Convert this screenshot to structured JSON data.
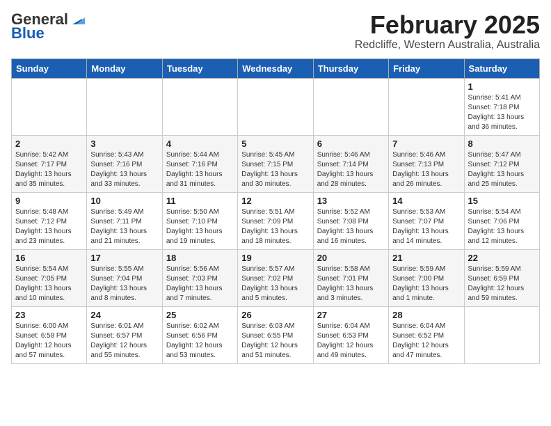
{
  "header": {
    "logo_general": "General",
    "logo_blue": "Blue",
    "title": "February 2025",
    "subtitle": "Redcliffe, Western Australia, Australia"
  },
  "weekdays": [
    "Sunday",
    "Monday",
    "Tuesday",
    "Wednesday",
    "Thursday",
    "Friday",
    "Saturday"
  ],
  "weeks": [
    [
      {
        "day": "",
        "info": ""
      },
      {
        "day": "",
        "info": ""
      },
      {
        "day": "",
        "info": ""
      },
      {
        "day": "",
        "info": ""
      },
      {
        "day": "",
        "info": ""
      },
      {
        "day": "",
        "info": ""
      },
      {
        "day": "1",
        "info": "Sunrise: 5:41 AM\nSunset: 7:18 PM\nDaylight: 13 hours\nand 36 minutes."
      }
    ],
    [
      {
        "day": "2",
        "info": "Sunrise: 5:42 AM\nSunset: 7:17 PM\nDaylight: 13 hours\nand 35 minutes."
      },
      {
        "day": "3",
        "info": "Sunrise: 5:43 AM\nSunset: 7:16 PM\nDaylight: 13 hours\nand 33 minutes."
      },
      {
        "day": "4",
        "info": "Sunrise: 5:44 AM\nSunset: 7:16 PM\nDaylight: 13 hours\nand 31 minutes."
      },
      {
        "day": "5",
        "info": "Sunrise: 5:45 AM\nSunset: 7:15 PM\nDaylight: 13 hours\nand 30 minutes."
      },
      {
        "day": "6",
        "info": "Sunrise: 5:46 AM\nSunset: 7:14 PM\nDaylight: 13 hours\nand 28 minutes."
      },
      {
        "day": "7",
        "info": "Sunrise: 5:46 AM\nSunset: 7:13 PM\nDaylight: 13 hours\nand 26 minutes."
      },
      {
        "day": "8",
        "info": "Sunrise: 5:47 AM\nSunset: 7:12 PM\nDaylight: 13 hours\nand 25 minutes."
      }
    ],
    [
      {
        "day": "9",
        "info": "Sunrise: 5:48 AM\nSunset: 7:12 PM\nDaylight: 13 hours\nand 23 minutes."
      },
      {
        "day": "10",
        "info": "Sunrise: 5:49 AM\nSunset: 7:11 PM\nDaylight: 13 hours\nand 21 minutes."
      },
      {
        "day": "11",
        "info": "Sunrise: 5:50 AM\nSunset: 7:10 PM\nDaylight: 13 hours\nand 19 minutes."
      },
      {
        "day": "12",
        "info": "Sunrise: 5:51 AM\nSunset: 7:09 PM\nDaylight: 13 hours\nand 18 minutes."
      },
      {
        "day": "13",
        "info": "Sunrise: 5:52 AM\nSunset: 7:08 PM\nDaylight: 13 hours\nand 16 minutes."
      },
      {
        "day": "14",
        "info": "Sunrise: 5:53 AM\nSunset: 7:07 PM\nDaylight: 13 hours\nand 14 minutes."
      },
      {
        "day": "15",
        "info": "Sunrise: 5:54 AM\nSunset: 7:06 PM\nDaylight: 13 hours\nand 12 minutes."
      }
    ],
    [
      {
        "day": "16",
        "info": "Sunrise: 5:54 AM\nSunset: 7:05 PM\nDaylight: 13 hours\nand 10 minutes."
      },
      {
        "day": "17",
        "info": "Sunrise: 5:55 AM\nSunset: 7:04 PM\nDaylight: 13 hours\nand 8 minutes."
      },
      {
        "day": "18",
        "info": "Sunrise: 5:56 AM\nSunset: 7:03 PM\nDaylight: 13 hours\nand 7 minutes."
      },
      {
        "day": "19",
        "info": "Sunrise: 5:57 AM\nSunset: 7:02 PM\nDaylight: 13 hours\nand 5 minutes."
      },
      {
        "day": "20",
        "info": "Sunrise: 5:58 AM\nSunset: 7:01 PM\nDaylight: 13 hours\nand 3 minutes."
      },
      {
        "day": "21",
        "info": "Sunrise: 5:59 AM\nSunset: 7:00 PM\nDaylight: 13 hours\nand 1 minute."
      },
      {
        "day": "22",
        "info": "Sunrise: 5:59 AM\nSunset: 6:59 PM\nDaylight: 12 hours\nand 59 minutes."
      }
    ],
    [
      {
        "day": "23",
        "info": "Sunrise: 6:00 AM\nSunset: 6:58 PM\nDaylight: 12 hours\nand 57 minutes."
      },
      {
        "day": "24",
        "info": "Sunrise: 6:01 AM\nSunset: 6:57 PM\nDaylight: 12 hours\nand 55 minutes."
      },
      {
        "day": "25",
        "info": "Sunrise: 6:02 AM\nSunset: 6:56 PM\nDaylight: 12 hours\nand 53 minutes."
      },
      {
        "day": "26",
        "info": "Sunrise: 6:03 AM\nSunset: 6:55 PM\nDaylight: 12 hours\nand 51 minutes."
      },
      {
        "day": "27",
        "info": "Sunrise: 6:04 AM\nSunset: 6:53 PM\nDaylight: 12 hours\nand 49 minutes."
      },
      {
        "day": "28",
        "info": "Sunrise: 6:04 AM\nSunset: 6:52 PM\nDaylight: 12 hours\nand 47 minutes."
      },
      {
        "day": "",
        "info": ""
      }
    ]
  ]
}
